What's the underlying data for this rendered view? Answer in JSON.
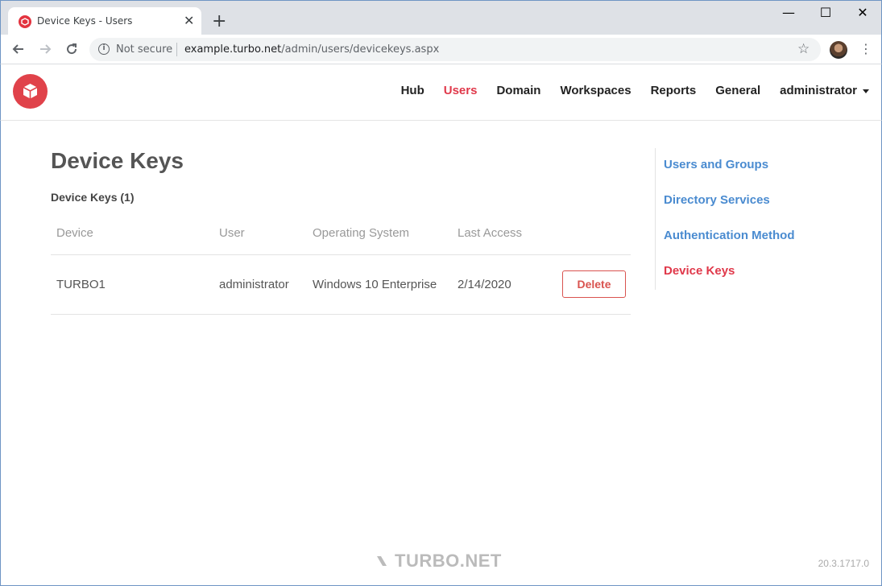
{
  "browser": {
    "tab_title": "Device Keys - Users",
    "tab_close": "✕",
    "new_tab": "+",
    "security_label": "Not secure",
    "url_host": "example.turbo.net",
    "url_path": "/admin/users/devicekeys.aspx",
    "window_controls": {
      "minimize": "—",
      "maximize": "☐",
      "close": "✕"
    }
  },
  "nav": {
    "items": [
      {
        "label": "Hub",
        "active": false
      },
      {
        "label": "Users",
        "active": true
      },
      {
        "label": "Domain",
        "active": false
      },
      {
        "label": "Workspaces",
        "active": false
      },
      {
        "label": "Reports",
        "active": false
      },
      {
        "label": "General",
        "active": false
      }
    ],
    "user_menu": "administrator"
  },
  "page": {
    "title": "Device Keys",
    "section_title": "Device Keys (1)"
  },
  "table": {
    "columns": [
      "Device",
      "User",
      "Operating System",
      "Last Access",
      ""
    ],
    "rows": [
      {
        "device": "TURBO1",
        "user": "administrator",
        "os": "Windows 10 Enterprise",
        "last_access": "2/14/2020",
        "action": "Delete"
      }
    ]
  },
  "sidebar": {
    "items": [
      {
        "label": "Users and Groups",
        "active": false
      },
      {
        "label": "Directory Services",
        "active": false
      },
      {
        "label": "Authentication Method",
        "active": false
      },
      {
        "label": "Device Keys",
        "active": true
      }
    ]
  },
  "footer": {
    "brand": "TURBO.NET",
    "version": "20.3.1717.0"
  },
  "colors": {
    "accent": "#e0384a",
    "link": "#4a8bd0",
    "delete": "#d9534f"
  }
}
